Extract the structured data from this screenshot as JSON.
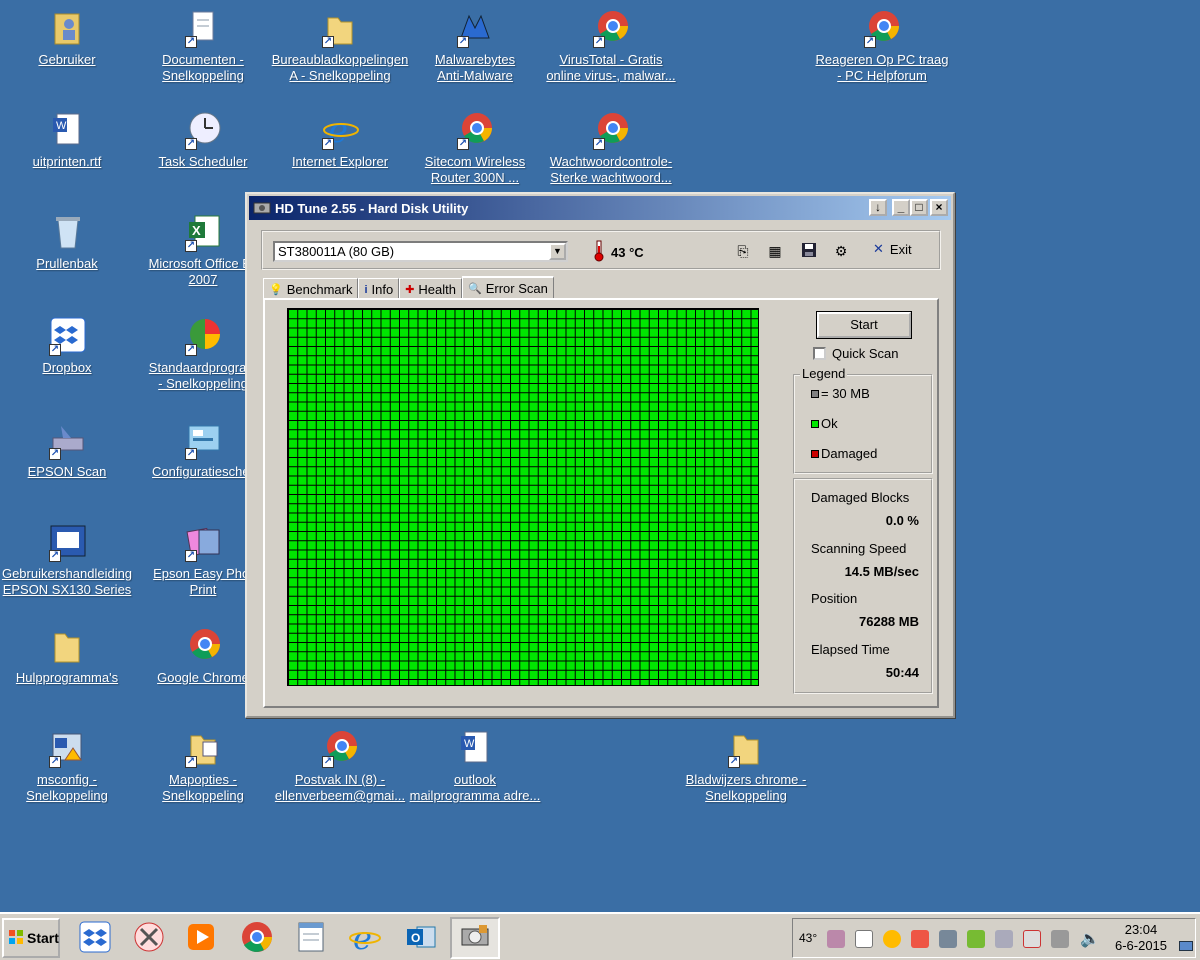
{
  "desktop": {
    "icons": [
      {
        "label1": "Gebruiker",
        "label2": ""
      },
      {
        "label1": "Documenten -",
        "label2": "Snelkoppeling"
      },
      {
        "label1": "Bureaubladkoppelingen",
        "label2": "A - Snelkoppeling"
      },
      {
        "label1": "Malwarebytes",
        "label2": "Anti-Malware"
      },
      {
        "label1": "VirusTotal - Gratis",
        "label2": "online virus-, malwar..."
      },
      {
        "label1": "Reageren Op PC traag",
        "label2": "- PC Helpforum"
      },
      {
        "label1": "uitprinten.rtf",
        "label2": ""
      },
      {
        "label1": "Task Scheduler",
        "label2": ""
      },
      {
        "label1": "Internet Explorer",
        "label2": ""
      },
      {
        "label1": "Sitecom Wireless",
        "label2": "Router 300N ..."
      },
      {
        "label1": "Wachtwoordcontrole-",
        "label2": "Sterke wachtwoord..."
      },
      {
        "label1": "Prullenbak",
        "label2": ""
      },
      {
        "label1": "Microsoft Office Ex",
        "label2": "2007"
      },
      {
        "label1": "Dropbox",
        "label2": ""
      },
      {
        "label1": "Standaardprogram",
        "label2": "- Snelkoppeling"
      },
      {
        "label1": "EPSON Scan",
        "label2": ""
      },
      {
        "label1": "Configuratiescher",
        "label2": ""
      },
      {
        "label1": "Gebruikershandleiding",
        "label2": "EPSON SX130 Series"
      },
      {
        "label1": "Epson Easy Phot",
        "label2": "Print"
      },
      {
        "label1": "Hulpprogramma's",
        "label2": ""
      },
      {
        "label1": "Google Chrome",
        "label2": ""
      },
      {
        "label1": "msconfig -",
        "label2": "Snelkoppeling"
      },
      {
        "label1": "Mapopties -",
        "label2": "Snelkoppeling"
      },
      {
        "label1": "Postvak IN (8) -",
        "label2": "ellenverbeem@gmai..."
      },
      {
        "label1": "outlook",
        "label2": "mailprogramma adre..."
      },
      {
        "label1": "Bladwijzers chrome -",
        "label2": "Snelkoppeling"
      }
    ]
  },
  "window": {
    "title": "HD Tune 2.55 - Hard Disk Utility",
    "drive": "ST380011A (80 GB)",
    "temperature": "43 °C",
    "exit_label": "Exit",
    "tabs": [
      {
        "label": "Benchmark"
      },
      {
        "label": "Info"
      },
      {
        "label": "Health"
      },
      {
        "label": "Error Scan"
      }
    ],
    "active_tab": "Error Scan",
    "start_label": "Start",
    "quick_scan_label": "Quick Scan",
    "quick_scan_checked": false,
    "legend": {
      "title": "Legend",
      "block_size": "= 30 MB",
      "ok": "Ok",
      "damaged": "Damaged"
    },
    "stats": {
      "damaged_blocks_label": "Damaged Blocks",
      "damaged_blocks_value": "0.0 %",
      "scanning_speed_label": "Scanning Speed",
      "scanning_speed_value": "14.5 MB/sec",
      "position_label": "Position",
      "position_value": "76288 MB",
      "elapsed_time_label": "Elapsed Time",
      "elapsed_time_value": "50:44"
    },
    "colors": {
      "ok": "#00e600",
      "damaged": "#cc0000",
      "block": "#808080"
    }
  },
  "taskbar": {
    "start_label": "Start",
    "apps": [
      "dropbox-icon",
      "snipping-tool-icon",
      "media-player-icon",
      "chrome-icon",
      "notepad-icon",
      "internet-explorer-icon",
      "outlook-icon",
      "hd-tune-icon"
    ],
    "tray_temp": "43°",
    "clock_time": "23:04",
    "clock_date": "6-6-2015"
  }
}
